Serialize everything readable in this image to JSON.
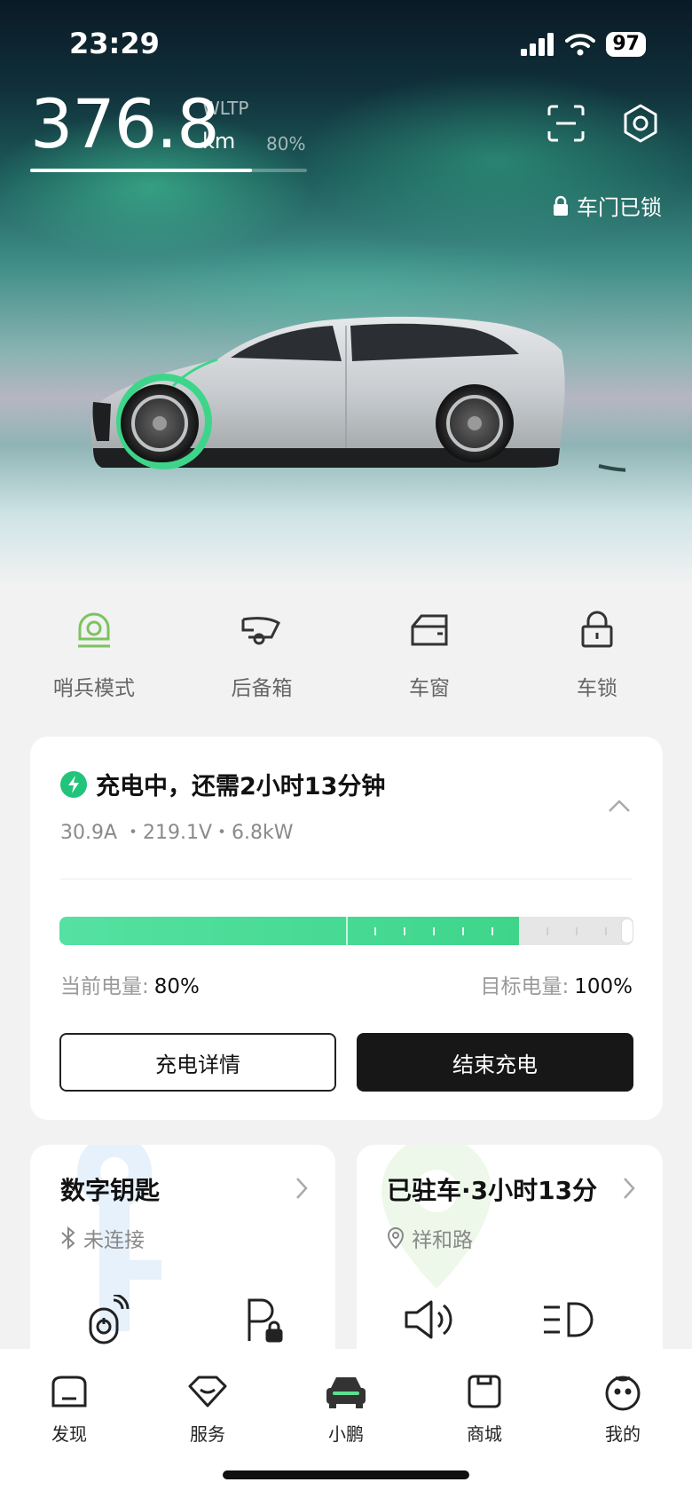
{
  "status_bar": {
    "time": "23:29",
    "battery": "97",
    "icons": [
      "signal-icon",
      "wifi-icon",
      "battery-icon"
    ]
  },
  "hero": {
    "range_value": "376.8",
    "range_standard": "WLTP",
    "range_unit": "km",
    "battery_percent_label": "80%",
    "range_fraction": 0.8,
    "door_status": "车门已锁",
    "accent_color": "#3ed58a"
  },
  "quick_actions": [
    {
      "label": "哨兵模式",
      "icon": "sentry-camera-icon"
    },
    {
      "label": "后备箱",
      "icon": "trunk-icon"
    },
    {
      "label": "车窗",
      "icon": "window-icon"
    },
    {
      "label": "车锁",
      "icon": "lock-icon"
    }
  ],
  "charging": {
    "title": "充电中，还需2小时13分钟",
    "metrics": "30.9A ・219.1V・6.8kW",
    "current_label": "当前电量:",
    "current_value": "80%",
    "target_label": "目标电量:",
    "target_value": "100%",
    "current_fraction": 0.8,
    "target_fraction": 1.0,
    "detail_button": "充电详情",
    "stop_button": "结束充电"
  },
  "digital_key": {
    "title": "数字钥匙",
    "status": "未连接"
  },
  "parking": {
    "title": "已驻车·3小时13分",
    "location": "祥和路"
  },
  "tabs": [
    {
      "label": "发现",
      "icon": "discover-icon"
    },
    {
      "label": "服务",
      "icon": "service-icon"
    },
    {
      "label": "小鹏",
      "icon": "car-icon",
      "active": true
    },
    {
      "label": "商城",
      "icon": "shop-icon"
    },
    {
      "label": "我的",
      "icon": "profile-icon"
    }
  ]
}
